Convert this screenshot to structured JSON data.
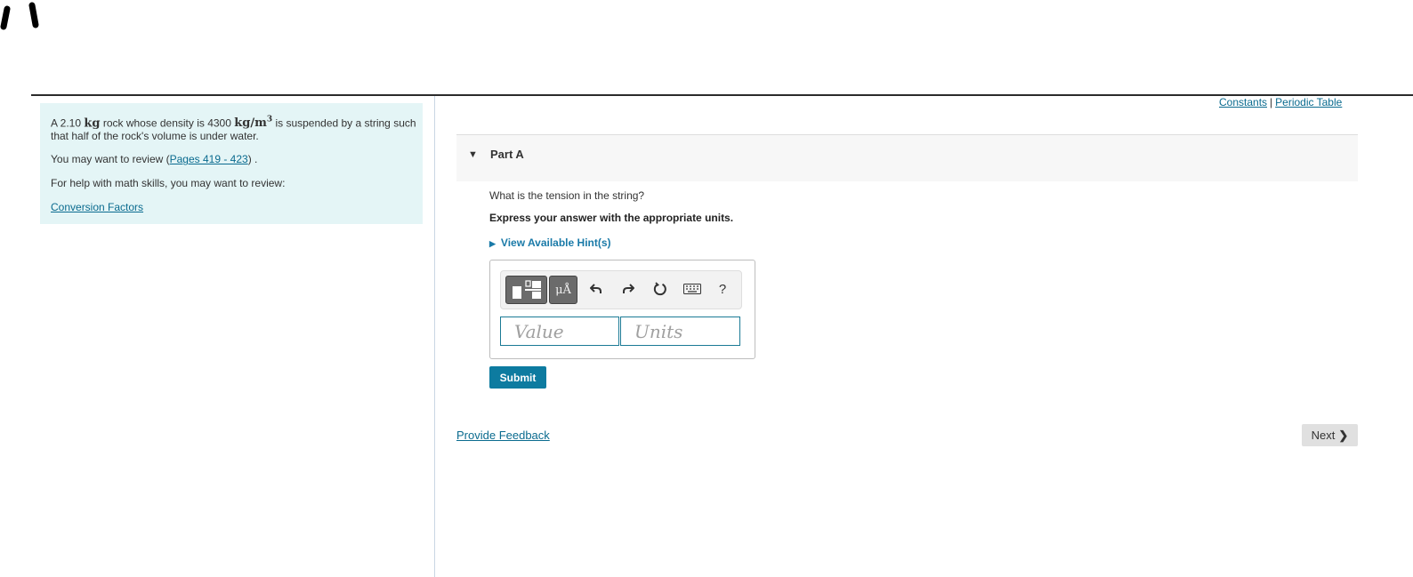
{
  "problem": {
    "text_pre": "A 2.10 ",
    "mass_unit": "kg",
    "text_mid": " rock whose density is 4300 ",
    "density_unit_base": "kg/m",
    "density_unit_exp": "3",
    "text_post": " is suspended by a string such that half of the rock's volume is under water.",
    "review_prefix": "You may want to review (",
    "review_link": "Pages 419 - 423",
    "review_suffix": ") .",
    "math_help": "For help with math skills, you may want to review:",
    "conversion_link": "Conversion Factors"
  },
  "top_links": {
    "constants": "Constants",
    "separator": "|",
    "periodic_table": "Periodic Table"
  },
  "part": {
    "title": "Part A",
    "question": "What is the tension in the string?",
    "instruction": "Express your answer with the appropriate units.",
    "hint_label": "View Available Hint(s)"
  },
  "toolbar": {
    "mu_label": "μÅ",
    "help_label": "?"
  },
  "answer": {
    "value_placeholder": "Value",
    "units_placeholder": "Units"
  },
  "buttons": {
    "submit": "Submit",
    "next": "Next"
  },
  "footer": {
    "feedback": "Provide Feedback"
  }
}
